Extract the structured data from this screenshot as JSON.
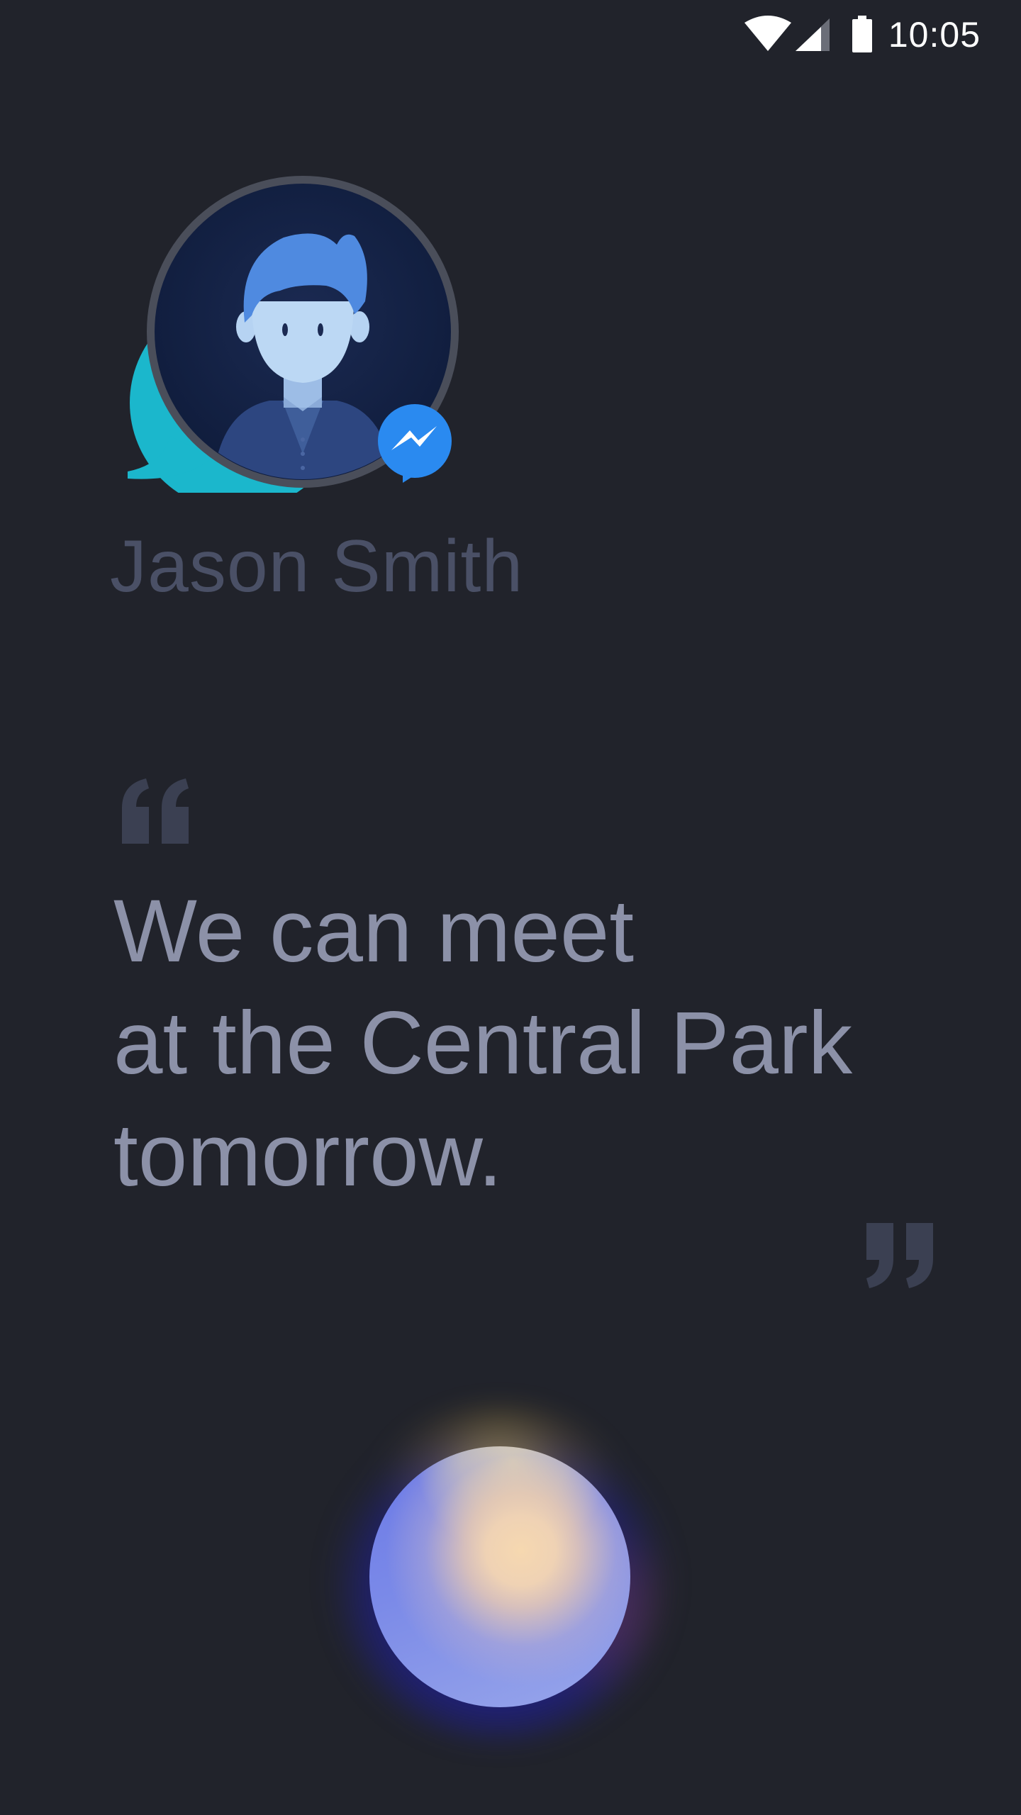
{
  "status_bar": {
    "time": "10:05",
    "icons": [
      "wifi-icon",
      "cellular-signal-icon",
      "battery-icon"
    ]
  },
  "contact": {
    "name": "Jason Smith",
    "app_badge": "messenger-icon"
  },
  "message": {
    "lines": [
      "We can meet",
      "at the Central Park",
      "tomorrow."
    ]
  },
  "colors": {
    "background": "#21232b",
    "name_text": "#4a5066",
    "message_text": "#8c91a8",
    "quote_marks": "#3b4052",
    "chat_bubble": "#1bb7cc",
    "messenger_badge": "#2a8af0"
  }
}
